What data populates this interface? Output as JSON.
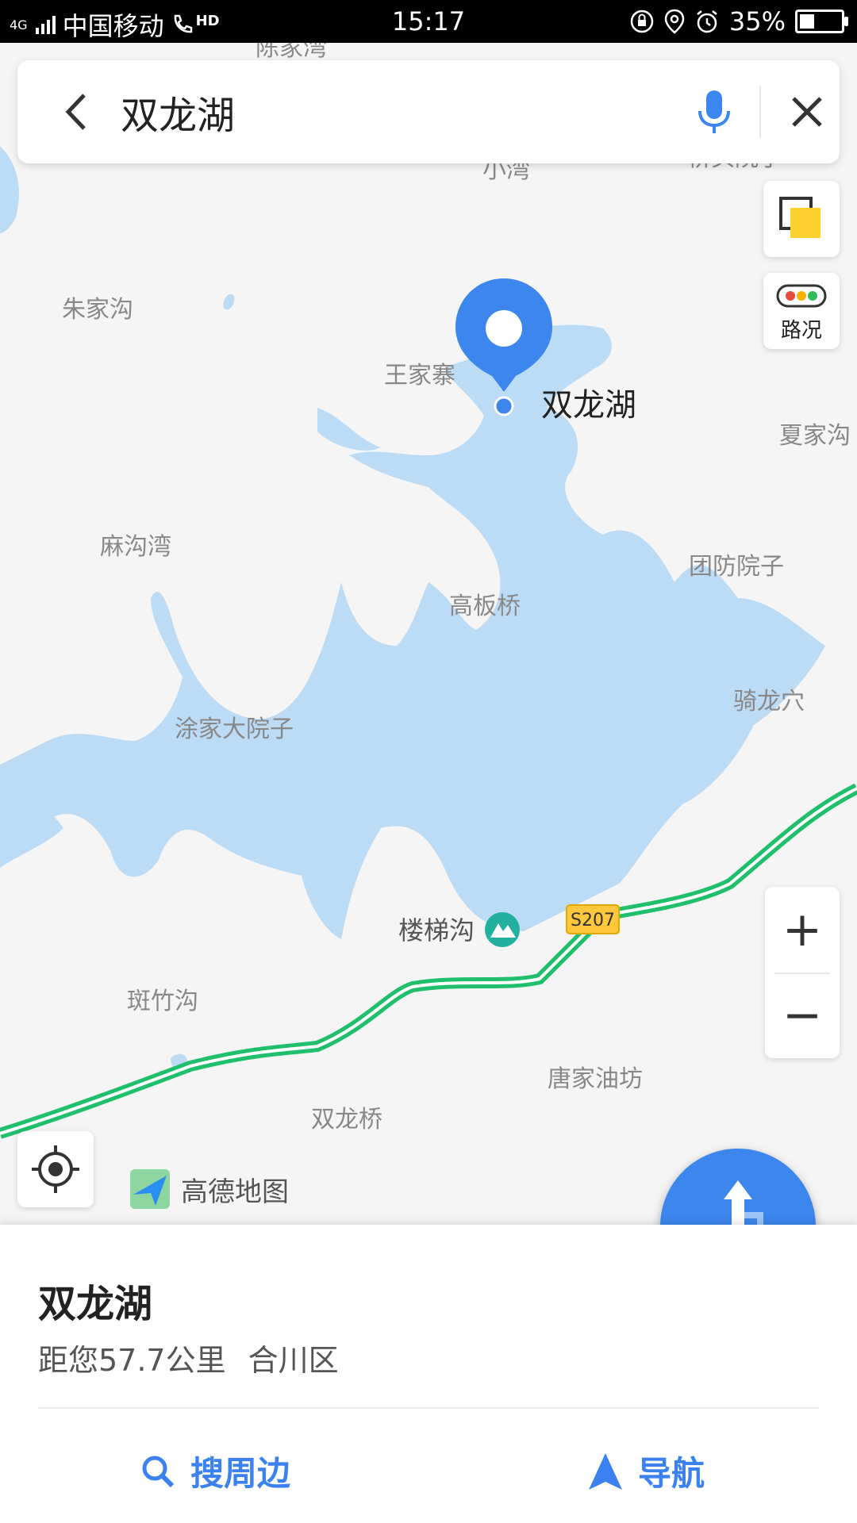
{
  "status_bar": {
    "network": "4G",
    "carrier": "中国移动",
    "hd": "HD",
    "time": "15:17",
    "battery_percent": "35%",
    "battery_level": 0.35
  },
  "search": {
    "query": "双龙湖"
  },
  "map_controls": {
    "traffic_label": "路况",
    "zoom_in": "+",
    "zoom_out": "−"
  },
  "map": {
    "selected_place": "双龙湖",
    "road_badge": "S207",
    "poi_label": "楼梯沟",
    "places": {
      "chen_jia_wan": "陈家湾",
      "xiao_wan": "小湾",
      "qiao_tou_yuan_zi": "桥头院子",
      "zhu_jia_gou": "朱家沟",
      "wang_jia_zhai": "王家寨",
      "xia_jia_gou": "夏家沟",
      "ma_gou_wan": "麻沟湾",
      "tuan_fang_yuan_zi": "团防院子",
      "gao_ban_qiao": "高板桥",
      "qi_long_xue": "骑龙穴",
      "tu_jia_da_yuan_zi": "涂家大院子",
      "ban_zhu_gou": "斑竹沟",
      "tang_jia_you_fang": "唐家油坊",
      "shuang_long_qiao": "双龙桥"
    },
    "logo_text": "高德地图",
    "colors": {
      "water": "#bcdcf6",
      "road": "#1fbf6b",
      "marker": "#3c86ee"
    }
  },
  "route_button": {
    "label": "路线"
  },
  "place_card": {
    "title": "双龙湖",
    "distance": "距您57.7公里",
    "district": "合川区",
    "nearby_label": "搜周边",
    "navigate_label": "导航"
  }
}
